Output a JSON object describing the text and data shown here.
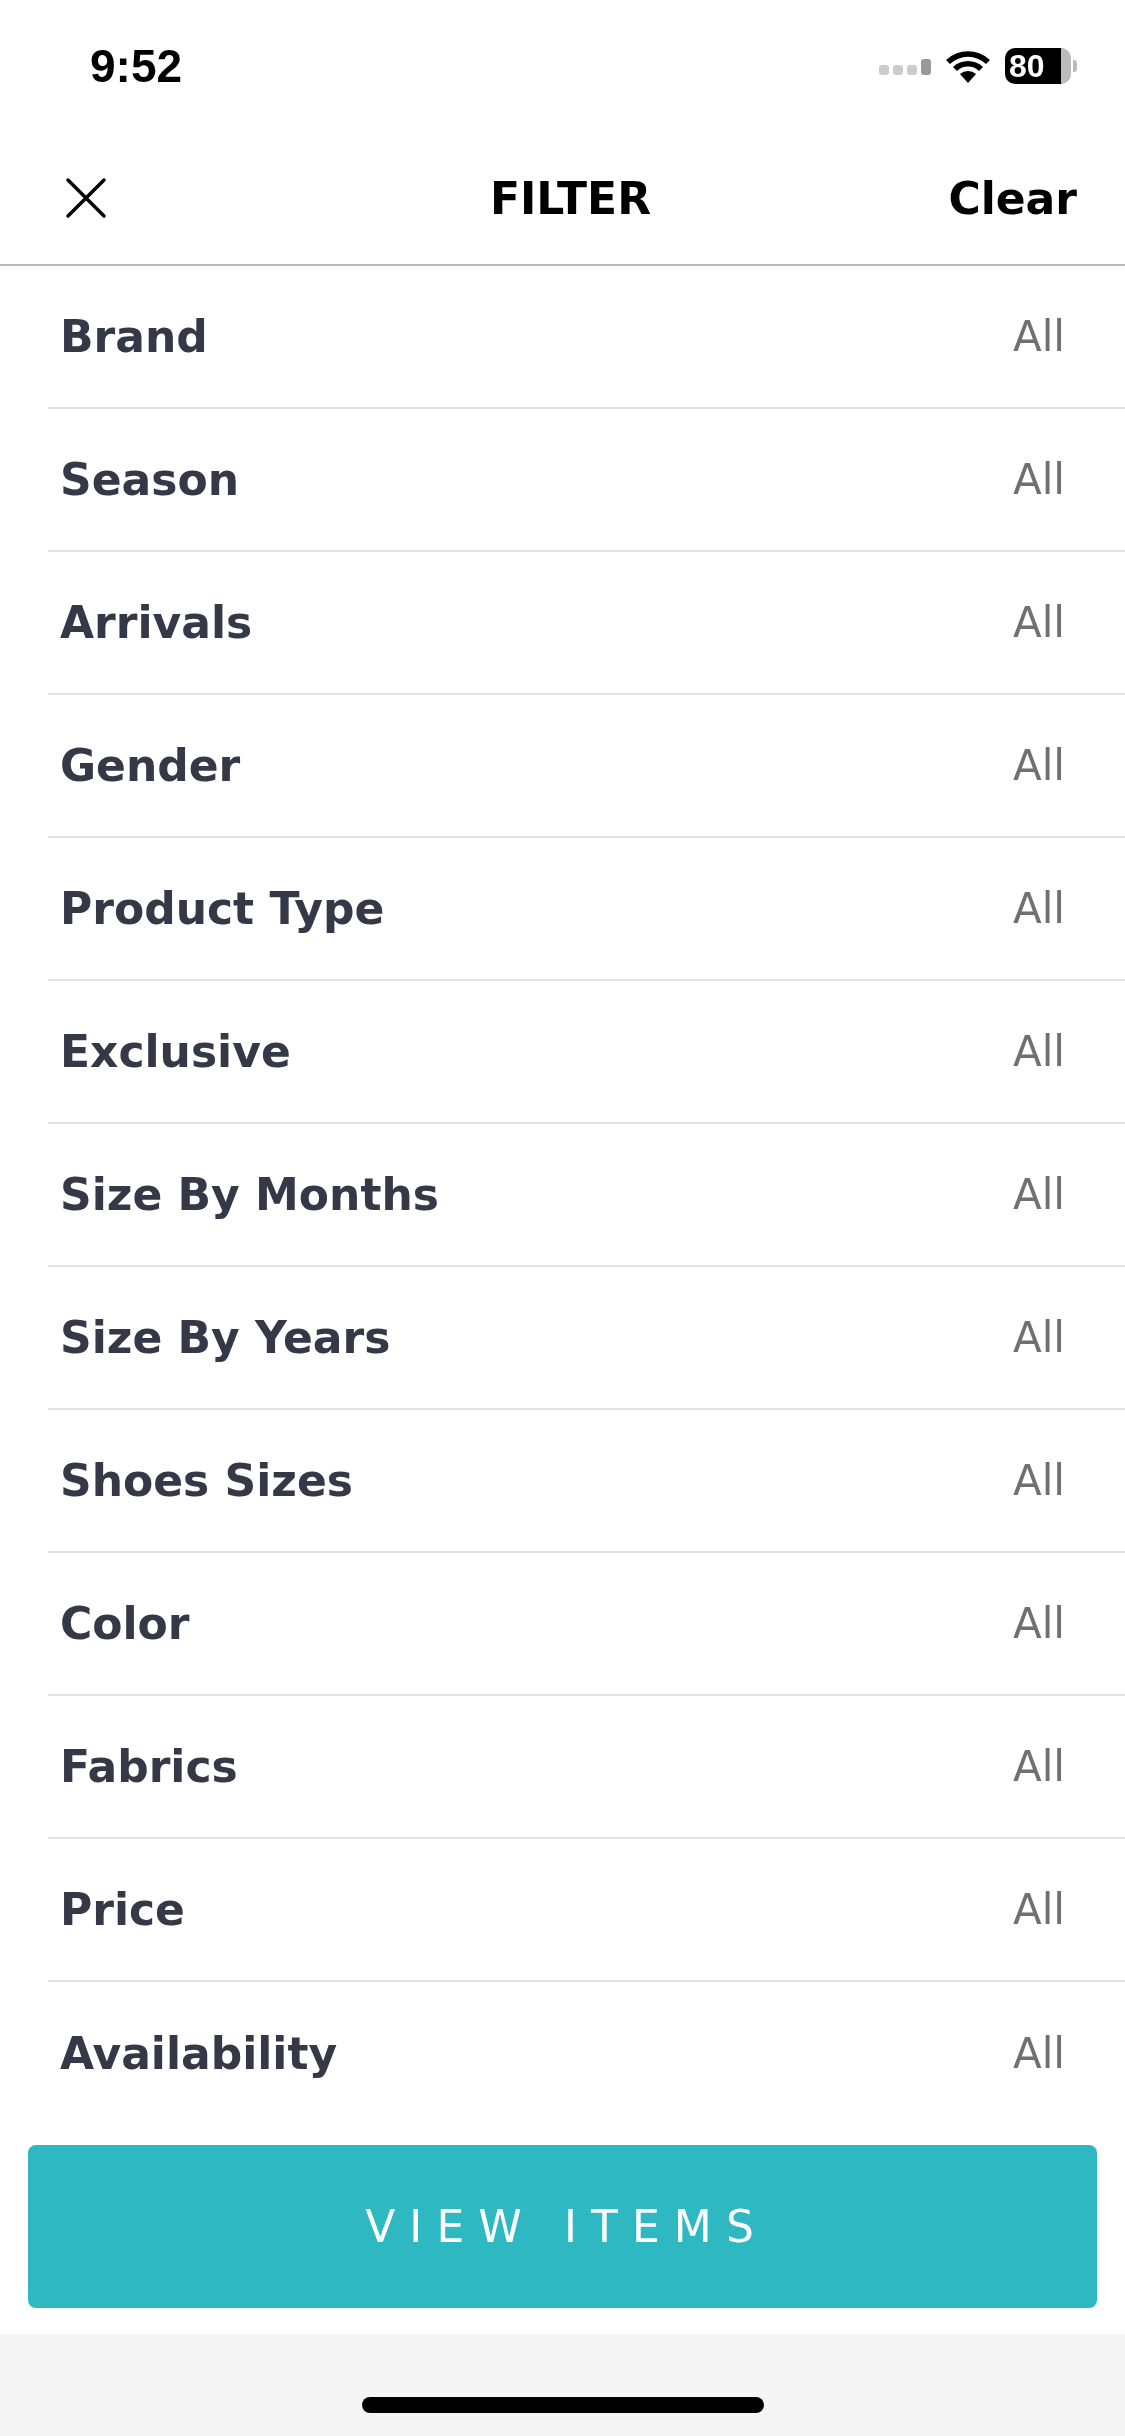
{
  "status_bar": {
    "time": "9:52",
    "battery": "80"
  },
  "header": {
    "title": "FILTER",
    "action": "Clear"
  },
  "filters": [
    {
      "label": "Brand",
      "value": "All"
    },
    {
      "label": "Season",
      "value": "All"
    },
    {
      "label": "Arrivals",
      "value": "All"
    },
    {
      "label": "Gender",
      "value": "All"
    },
    {
      "label": "Product Type",
      "value": "All"
    },
    {
      "label": "Exclusive",
      "value": "All"
    },
    {
      "label": "Size By Months",
      "value": "All"
    },
    {
      "label": "Size By Years",
      "value": "All"
    },
    {
      "label": "Shoes Sizes",
      "value": "All"
    },
    {
      "label": "Color",
      "value": "All"
    },
    {
      "label": "Fabrics",
      "value": "All"
    },
    {
      "label": "Price",
      "value": "All"
    },
    {
      "label": "Availability",
      "value": "All"
    }
  ],
  "button": "VIEW ITEMS"
}
